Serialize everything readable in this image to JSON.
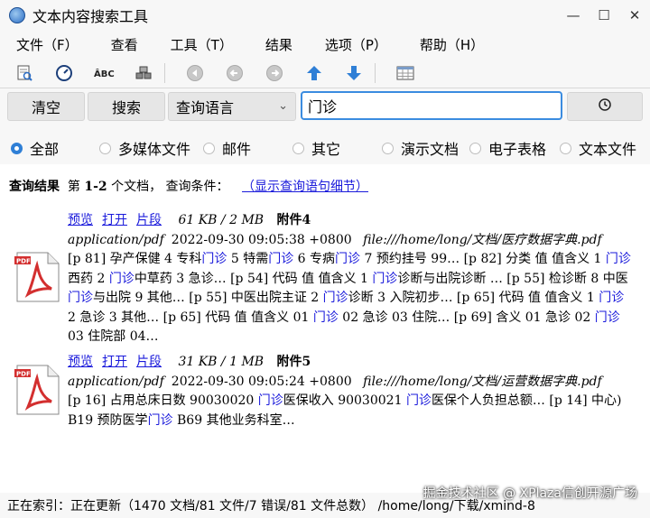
{
  "window": {
    "title": "文本内容搜索工具",
    "controls": [
      "minimize",
      "maximize",
      "close"
    ]
  },
  "menu": [
    "文件（F）",
    "查看",
    "工具（T）",
    "结果",
    "选项（P）",
    "帮助（H）"
  ],
  "toolbar": {
    "icons": [
      "preview-doc-icon",
      "gauge-icon",
      "spellcheck-icon",
      "indexes-icon",
      "first-page-icon",
      "previous-page-icon",
      "next-page-icon",
      "arrow-up-icon",
      "arrow-down-icon",
      "table-icon"
    ]
  },
  "search": {
    "clear_label": "清空",
    "search_label": "搜索",
    "query_language": "查询语言",
    "query_text": "门诊"
  },
  "filters": {
    "items": [
      "全部",
      "多媒体文件",
      "邮件",
      "其它",
      "演示文档",
      "电子表格",
      "文本文件"
    ],
    "selected": "全部"
  },
  "results": {
    "title": "查询结果",
    "summary_prefix": "第",
    "range": "1-2",
    "summary_suffix": "个文档，  查询条件：",
    "details_link": "（显示查询语句细节）",
    "entries": [
      {
        "links": [
          "预览",
          "打开",
          "片段"
        ],
        "size": "61 KB / 2 MB",
        "attachment": "附件4",
        "mime": "application/pdf",
        "date": "2022-09-30 09:05:38 +0800",
        "path": "file:///home/long/文档/医疗数据字典.pdf",
        "snippet_parts": [
          {
            "t": "[p 81] 孕产保健 4 专科"
          },
          {
            "t": "门诊",
            "hl": true
          },
          {
            "t": " 5 特需"
          },
          {
            "t": "门诊",
            "hl": true
          },
          {
            "t": " 6 专病"
          },
          {
            "t": "门诊",
            "hl": true
          },
          {
            "t": " 7 预约挂号 99… [p 82] 分类 值 值含义 1 "
          },
          {
            "t": "门诊",
            "hl": true
          },
          {
            "t": "西药 2 "
          },
          {
            "t": "门诊",
            "hl": true
          },
          {
            "t": "中草药 3 急诊… [p 54] 代码 值 值含义 1 "
          },
          {
            "t": "门诊",
            "hl": true
          },
          {
            "t": "诊断与出院诊断 … [p 55] 检诊断 8 中医"
          },
          {
            "t": "门诊",
            "hl": true
          },
          {
            "t": "与出院 9 其他… [p 55] 中医出院主证 2 "
          },
          {
            "t": "门诊",
            "hl": true
          },
          {
            "t": "诊断 3 入院初步… [p 65] 代码 值 值含义 1 "
          },
          {
            "t": "门诊",
            "hl": true
          },
          {
            "t": " 2 急诊 3 其他… [p 65] 代码 值 值含义 01 "
          },
          {
            "t": "门诊",
            "hl": true
          },
          {
            "t": " 02 急诊 03 住院… [p 69] 含义 01 急诊 02 "
          },
          {
            "t": "门诊",
            "hl": true
          },
          {
            "t": " 03 住院部 04…"
          }
        ]
      },
      {
        "links": [
          "预览",
          "打开",
          "片段"
        ],
        "size": "31 KB / 1 MB",
        "attachment": "附件5",
        "mime": "application/pdf",
        "date": "2022-09-30 09:05:24 +0800",
        "path": "file:///home/long/文档/运营数据字典.pdf",
        "snippet_parts": [
          {
            "t": "[p 16] 占用总床日数 90030020 "
          },
          {
            "t": "门诊",
            "hl": true
          },
          {
            "t": "医保收入 90030021 "
          },
          {
            "t": "门诊",
            "hl": true
          },
          {
            "t": "医保个人负担总额… [p 14] 中心) B19 预防医学"
          },
          {
            "t": "门诊",
            "hl": true
          },
          {
            "t": " B69 其他业务科室…"
          }
        ]
      }
    ]
  },
  "status": "正在索引：正在更新（1470 文档/81 文件/7 错误/81 文件总数） /home/long/下载/xmind-8",
  "watermark": "掘金技术社区 @ XPlaza信创开源广场"
}
